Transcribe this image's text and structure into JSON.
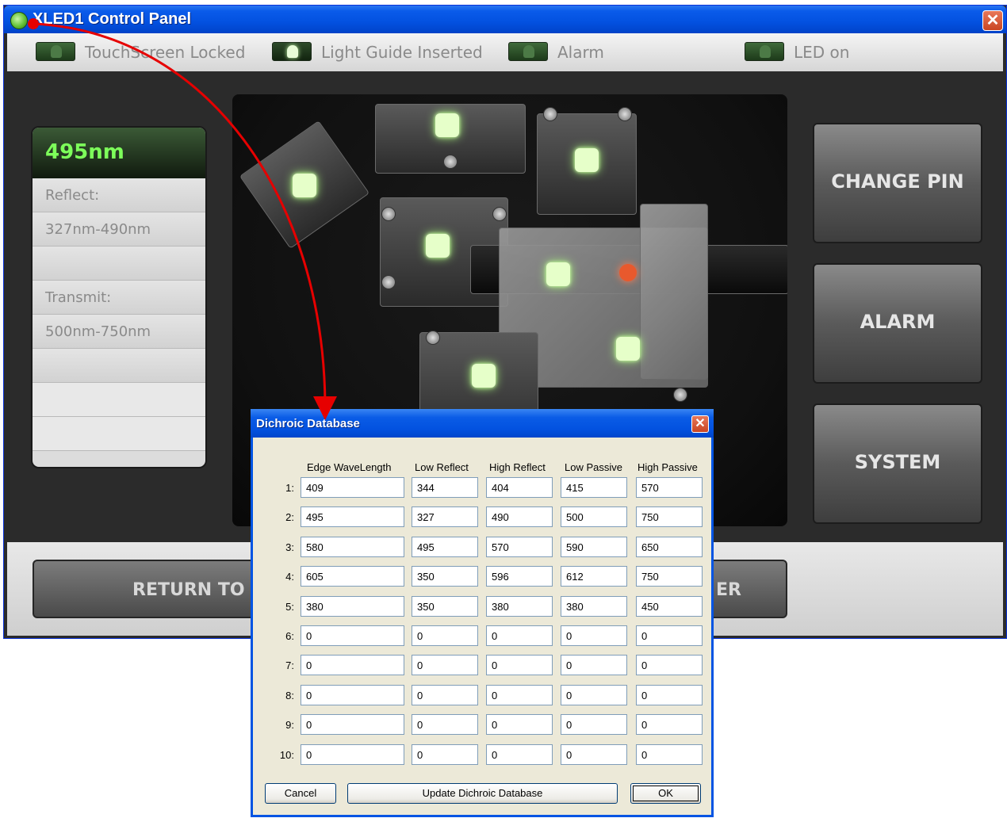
{
  "main_window": {
    "title": "XLED1 Control Panel",
    "close_label": "✕"
  },
  "status_bar": {
    "items": [
      {
        "label": "TouchScreen Locked",
        "active": false
      },
      {
        "label": "Light Guide Inserted",
        "active": true
      },
      {
        "label": "Alarm",
        "active": false
      },
      {
        "label": "LED on",
        "active": false
      }
    ]
  },
  "info_panel": {
    "wavelength": "495nm",
    "reflect_label": "Reflect:",
    "reflect_range": "327nm-490nm",
    "transmit_label": "Transmit:",
    "transmit_range": "500nm-750nm"
  },
  "side_buttons": {
    "change_pin": "CHANGE PIN",
    "alarm": "ALARM",
    "system": "SYSTEM"
  },
  "bottom_buttons": {
    "return_left_visible": "RETURN TO LE",
    "right_visible": "ER"
  },
  "dialog": {
    "title": "Dichroic Database",
    "close_label": "✕",
    "columns": [
      "Edge WaveLength",
      "Low Reflect",
      "High Reflect",
      "Low Passive",
      "High Passive"
    ],
    "rows": [
      {
        "label": "1:",
        "values": [
          "409",
          "344",
          "404",
          "415",
          "570"
        ]
      },
      {
        "label": "2:",
        "values": [
          "495",
          "327",
          "490",
          "500",
          "750"
        ]
      },
      {
        "label": "3:",
        "values": [
          "580",
          "495",
          "570",
          "590",
          "650"
        ]
      },
      {
        "label": "4:",
        "values": [
          "605",
          "350",
          "596",
          "612",
          "750"
        ]
      },
      {
        "label": "5:",
        "values": [
          "380",
          "350",
          "380",
          "380",
          "450"
        ]
      },
      {
        "label": "6:",
        "values": [
          "0",
          "0",
          "0",
          "0",
          "0"
        ]
      },
      {
        "label": "7:",
        "values": [
          "0",
          "0",
          "0",
          "0",
          "0"
        ]
      },
      {
        "label": "8:",
        "values": [
          "0",
          "0",
          "0",
          "0",
          "0"
        ]
      },
      {
        "label": "9:",
        "values": [
          "0",
          "0",
          "0",
          "0",
          "0"
        ]
      },
      {
        "label": "10:",
        "values": [
          "0",
          "0",
          "0",
          "0",
          "0"
        ]
      }
    ],
    "buttons": {
      "cancel": "Cancel",
      "update": "Update Dichroic Database",
      "ok": "OK"
    }
  },
  "colors": {
    "titlebar_blue": "#0351e0",
    "wavelength_green": "#7dff5a",
    "led_pad_green": "#e6ffc9",
    "alarm_red": "#e8592d",
    "arrow_red": "#e60000"
  }
}
